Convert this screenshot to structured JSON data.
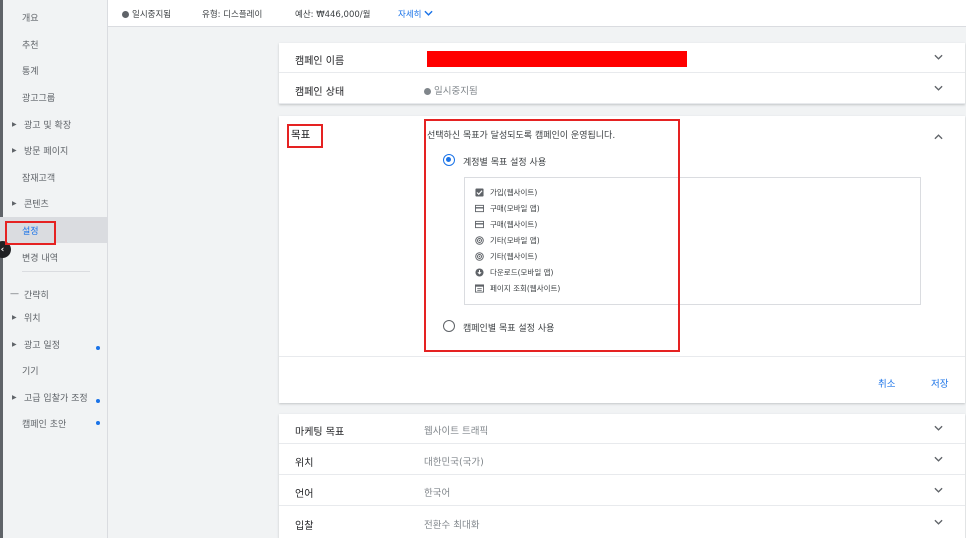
{
  "topbar": {
    "status": "일시중지됨",
    "type": "유형: 디스플레이",
    "budget": "예산: ₩446,000/월",
    "more": "자세히"
  },
  "sidebar": {
    "items": [
      {
        "label": "개요",
        "caret": false
      },
      {
        "label": "추천",
        "caret": false
      },
      {
        "label": "통계",
        "caret": false
      },
      {
        "label": "광고그룹",
        "caret": false
      },
      {
        "label": "광고 및 확장",
        "caret": true
      },
      {
        "label": "방문 페이지",
        "caret": true
      },
      {
        "label": "잠재고객",
        "caret": false
      },
      {
        "label": "콘텐츠",
        "caret": true
      },
      {
        "label": "설정",
        "caret": false,
        "active": true
      },
      {
        "label": "변경 내역",
        "caret": false
      },
      {
        "label": "간략히",
        "caret": false
      },
      {
        "label": "위치",
        "caret": true
      },
      {
        "label": "광고 일정",
        "caret": true,
        "dot": true
      },
      {
        "label": "기기",
        "caret": false
      },
      {
        "label": "고급 입찰가 조정",
        "caret": true,
        "dot": true
      },
      {
        "label": "캠페인 초안",
        "caret": false,
        "dot": true
      }
    ]
  },
  "settings": {
    "campaign_name_key": "캠페인 이름",
    "campaign_status_key": "캠페인 상태",
    "campaign_status_value": "일시중지됨",
    "goal": {
      "title": "목표",
      "description": "선택하신 목표가 달성되도록 캠페인이 운영됩니다.",
      "option_account": "계정별 목표 설정 사용",
      "option_campaign": "캠페인별 목표 설정 사용",
      "items": [
        {
          "label": "가입(웹사이트)",
          "icon": "checkbox-icon"
        },
        {
          "label": "구매(모바일 앱)",
          "icon": "card-icon"
        },
        {
          "label": "구매(웹사이트)",
          "icon": "card-icon"
        },
        {
          "label": "기타(모바일 앱)",
          "icon": "target-icon"
        },
        {
          "label": "기타(웹사이트)",
          "icon": "target-icon"
        },
        {
          "label": "다운로드(모바일 앱)",
          "icon": "download-icon"
        },
        {
          "label": "페이지 조회(웹사이트)",
          "icon": "page-icon"
        }
      ],
      "cancel": "취소",
      "save": "저장"
    },
    "rows": [
      {
        "key": "마케팅 목표",
        "value": "웹사이트 트래픽"
      },
      {
        "key": "위치",
        "value": "대한민국(국가)"
      },
      {
        "key": "언어",
        "value": "한국어"
      },
      {
        "key": "입찰",
        "value": "전환수 최대화"
      }
    ]
  },
  "colors": {
    "accent": "#1a73e8",
    "highlight": "#e52222",
    "redaction": "#ff0000"
  }
}
